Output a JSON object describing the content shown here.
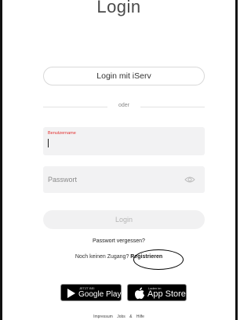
{
  "title": "Login",
  "iserv_button": "Login mit iServ",
  "divider_text": "oder",
  "username": {
    "label": "Benutzername",
    "value": ""
  },
  "password": {
    "placeholder": "Passwort"
  },
  "login_button": "Login",
  "forgot_password": "Passwort vergessen?",
  "no_account": {
    "text": "Noch keinen Zugang?",
    "register": "Registrieren"
  },
  "stores": {
    "google": {
      "small": "JETZT BEI",
      "big": "Google Play",
      "icon": "google-play-icon"
    },
    "apple": {
      "small": "Laden im",
      "big": "App Store",
      "icon": "apple-icon"
    }
  },
  "footer": {
    "imprint": "Impressum",
    "help": "Jobs & Hilfe"
  },
  "colors": {
    "error_red": "#e2302f",
    "field_bg": "#f2f2f3"
  }
}
